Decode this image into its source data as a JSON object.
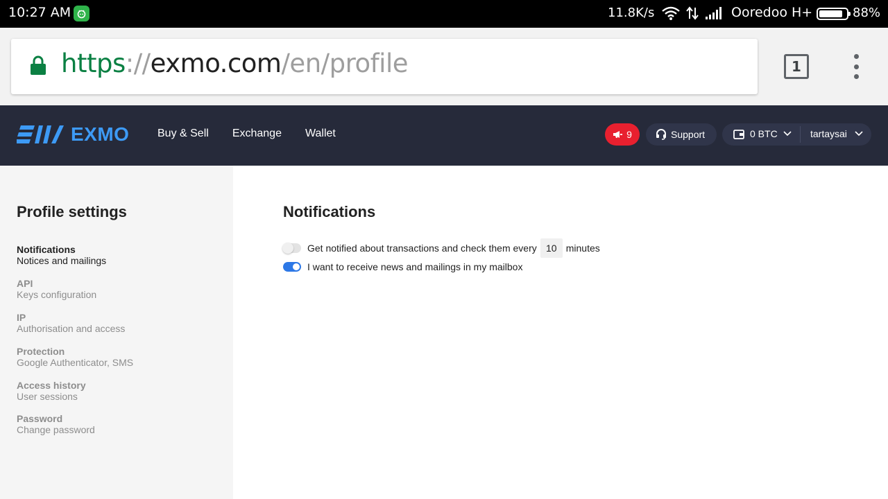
{
  "status_bar": {
    "time": "10:27 AM",
    "net_speed": "11.8K/s",
    "carrier": "Ooredoo H+",
    "battery_percent": "88%",
    "battery_level": 0.88
  },
  "browser": {
    "url_scheme": "https",
    "url_sep": "://",
    "url_host": "exmo.com",
    "url_path": "/en/profile",
    "tab_count": "1"
  },
  "header": {
    "logo_text": "EXMO",
    "nav": [
      "Buy & Sell",
      "Exchange",
      "Wallet"
    ],
    "notifications_count": "9",
    "support_label": "Support",
    "balance": "0 BTC",
    "username": "tartaysai",
    "accent_color": "#3d9af5",
    "badge_color": "#e8202f"
  },
  "sidebar": {
    "title": "Profile settings",
    "items": [
      {
        "title": "Notifications",
        "subtitle": "Notices and mailings"
      },
      {
        "title": "API",
        "subtitle": "Keys configuration"
      },
      {
        "title": "IP",
        "subtitle": "Authorisation and access"
      },
      {
        "title": "Protection",
        "subtitle": "Google Authenticator, SMS"
      },
      {
        "title": "Access history",
        "subtitle": "User sessions"
      },
      {
        "title": "Password",
        "subtitle": "Change password"
      }
    ]
  },
  "main": {
    "title": "Notifications",
    "settings": [
      {
        "label_before": "Get notified about transactions and check them every",
        "value": "10",
        "label_after": "minutes",
        "enabled": false
      },
      {
        "label": "I want to receive news and mailings in my mailbox",
        "enabled": true
      }
    ]
  }
}
